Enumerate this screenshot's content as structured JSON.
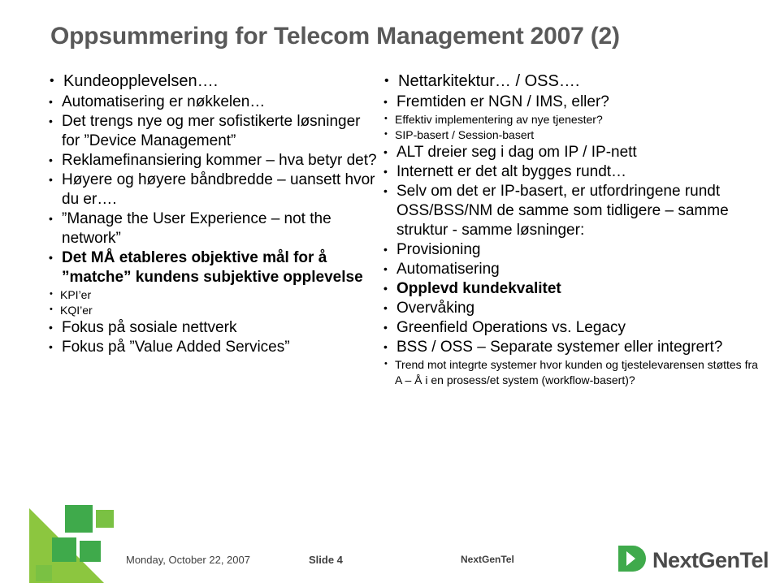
{
  "slide": {
    "title": "Oppsummering for Telecom Management  2007 (2)",
    "left_column": [
      {
        "level": 1,
        "text": "Kundeopplevelsen…."
      },
      {
        "level": 2,
        "text": "Automatisering er nøkkelen…"
      },
      {
        "level": 2,
        "text": "Det trengs nye og mer sofistikerte løsninger for ”Device Management”"
      },
      {
        "level": 2,
        "text": "Reklamefinansiering kommer – hva betyr det?"
      },
      {
        "level": 2,
        "text": "Høyere og høyere båndbredde – uansett hvor du er…."
      },
      {
        "level": 2,
        "text": "”Manage the User Experience – not the network”"
      },
      {
        "level": 2,
        "text": "Det MÅ etableres objektive mål for å ”matche” kundens subjektive opplevelse",
        "bold": true
      },
      {
        "level": 3,
        "text": "KPI’er"
      },
      {
        "level": 3,
        "text": "KQI’er"
      },
      {
        "level": 2,
        "text": "Fokus på sosiale nettverk"
      },
      {
        "level": 2,
        "text": "Fokus på ”Value Added Services”"
      }
    ],
    "right_column": [
      {
        "level": 1,
        "text": "Nettarkitektur… / OSS…."
      },
      {
        "level": 2,
        "text": "Fremtiden er NGN / IMS, eller?"
      },
      {
        "level": 3,
        "text": "Effektiv implementering av nye tjenester?"
      },
      {
        "level": 3,
        "text": "SIP-basert / Session-basert"
      },
      {
        "level": 2,
        "text": "ALT dreier seg i dag om IP / IP-nett"
      },
      {
        "level": 2,
        "text": "Internett er det alt bygges rundt…"
      },
      {
        "level": 2,
        "text": "Selv om det er IP-basert, er utfordringene rundt OSS/BSS/NM de samme som tidligere – samme struktur  - samme løsninger:"
      },
      {
        "level": 2,
        "text": "Provisioning"
      },
      {
        "level": 2,
        "text": "Automatisering"
      },
      {
        "level": 2,
        "text": "Opplevd kundekvalitet",
        "bold": true
      },
      {
        "level": 2,
        "text": "Overvåking"
      },
      {
        "level": 2,
        "text": "Greenfield Operations vs. Legacy"
      },
      {
        "level": 2,
        "text": "BSS / OSS – Separate systemer eller integrert?"
      },
      {
        "level": 3,
        "text": "Trend mot integrte systemer hvor kunden og tjestelevarensen støttes fra A – Å i en prosess/et system (workflow-basert)?"
      }
    ],
    "footer": {
      "date": "Monday, October 22, 2007",
      "slide_number": "Slide 4",
      "company": "NextGenTel"
    },
    "logo": {
      "text": "NextGenTel"
    },
    "colors": {
      "title": "#595959",
      "brand_green": "#58b14c",
      "brand_green_light": "#8cc63f",
      "logo_gray": "#4a4a4a"
    }
  }
}
